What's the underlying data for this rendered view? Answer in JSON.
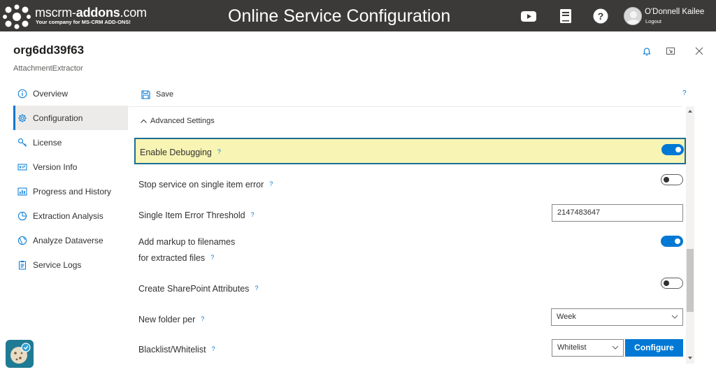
{
  "topbar": {
    "logo_name_prefix": "mscrm-",
    "logo_name_bold": "addons",
    "logo_name_suffix": ".com",
    "logo_tagline": "Your company for MS-CRM ADD-ONS!",
    "app_title": "Online Service Configuration",
    "icons": [
      "youtube-icon",
      "book-icon",
      "help-icon"
    ],
    "user_name": "O'Donnell Kailee",
    "logout_label": "Logout",
    "bg_color": "#3b3a39"
  },
  "header": {
    "org_name": "org6dd39f63",
    "product": "AttachmentExtractor",
    "icons": [
      "bell-icon",
      "minimize-icon",
      "close-icon"
    ]
  },
  "sidebar": {
    "items": [
      {
        "label": "Overview",
        "icon": "info-icon",
        "active": false
      },
      {
        "label": "Configuration",
        "icon": "gear-icon",
        "active": true
      },
      {
        "label": "License",
        "icon": "key-icon",
        "active": false
      },
      {
        "label": "Version Info",
        "icon": "version-icon",
        "active": false
      },
      {
        "label": "Progress and History",
        "icon": "chart-icon",
        "active": false
      },
      {
        "label": "Extraction Analysis",
        "icon": "pie-icon",
        "active": false
      },
      {
        "label": "Analyze Dataverse",
        "icon": "globe-icon",
        "active": false
      },
      {
        "label": "Service Logs",
        "icon": "clipboard-icon",
        "active": false
      }
    ],
    "accent_color": "#0078d4"
  },
  "toolbar": {
    "save_label": "Save",
    "help_mark": "?"
  },
  "section": {
    "title": "Advanced Settings",
    "expanded": true
  },
  "settings": {
    "help_mark": "?",
    "enable_debugging": {
      "label": "Enable Debugging",
      "value": true,
      "highlight_color": "#f8f5b4"
    },
    "stop_service": {
      "label": "Stop service on single item error",
      "value": false
    },
    "error_threshold": {
      "label": "Single Item Error Threshold",
      "value": "2147483647"
    },
    "add_markup": {
      "label_line1": "Add markup to filenames",
      "label_line2": "for extracted files",
      "value": true
    },
    "sharepoint_attrs": {
      "label": "Create SharePoint Attributes",
      "value": false
    },
    "new_folder": {
      "label": "New folder per",
      "selected": "Week"
    },
    "blacklist": {
      "label": "Blacklist/Whitelist",
      "selected": "Whitelist",
      "configure_label": "Configure"
    }
  },
  "widgets": {
    "cookie_icon": "cookie-icon"
  }
}
